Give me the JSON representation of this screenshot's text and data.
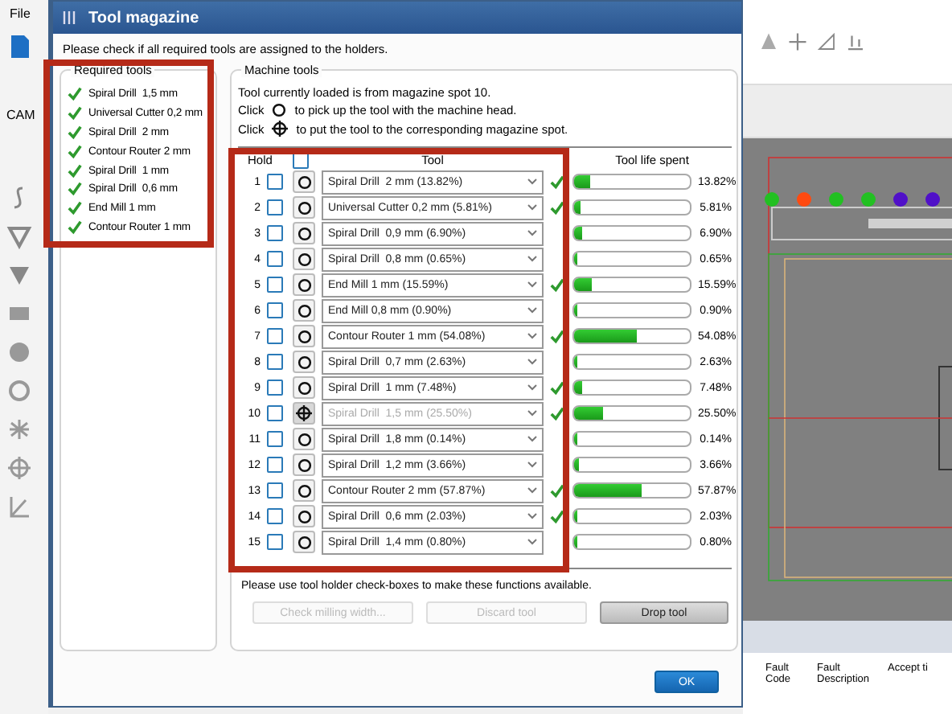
{
  "app": {
    "menu": "File",
    "tab": "CAM"
  },
  "dialog": {
    "title": "Tool magazine",
    "instruction": "Please check if all required tools are assigned to the holders.",
    "required_tools": {
      "title": "Required tools",
      "items": [
        {
          "label": "Spiral Drill  1,5 mm",
          "assigned": true
        },
        {
          "label": "Universal Cutter 0,2 mm",
          "assigned": true
        },
        {
          "label": "Spiral Drill  2 mm",
          "assigned": true
        },
        {
          "label": "Contour Router 2 mm",
          "assigned": true
        },
        {
          "label": "Spiral Drill  1 mm",
          "assigned": true
        },
        {
          "label": "Spiral Drill  0,6 mm",
          "assigned": true
        },
        {
          "label": "End Mill 1 mm",
          "assigned": true
        },
        {
          "label": "Contour Router 1 mm",
          "assigned": true
        }
      ]
    },
    "machine_tools": {
      "title": "Machine tools",
      "info": "Tool currently loaded is from magazine spot 10.",
      "hints": [
        {
          "kind": "pick",
          "before": "Click",
          "after": "to pick up the tool with the machine head."
        },
        {
          "kind": "put",
          "before": "Click",
          "after": "to put the tool to the corresponding magazine spot."
        }
      ],
      "columns": [
        "Hold",
        "Tool",
        "Tool life spent"
      ],
      "all_checked": false,
      "rows": [
        {
          "number": "1",
          "checked": false,
          "kind": "pick",
          "tool": "Spiral Drill  2 mm (13.82%)",
          "disabled": false,
          "assigned": true,
          "level": 0.1382,
          "percent": "13.82%"
        },
        {
          "number": "2",
          "checked": false,
          "kind": "pick",
          "tool": "Universal Cutter 0,2 mm (5.81%)",
          "disabled": false,
          "assigned": true,
          "level": 0.0581,
          "percent": "5.81%"
        },
        {
          "number": "3",
          "checked": false,
          "kind": "pick",
          "tool": "Spiral Drill  0,9 mm (6.90%)",
          "disabled": false,
          "assigned": false,
          "level": 0.069,
          "percent": "6.90%"
        },
        {
          "number": "4",
          "checked": false,
          "kind": "pick",
          "tool": "Spiral Drill  0,8 mm (0.65%)",
          "disabled": false,
          "assigned": false,
          "level": 0.0065,
          "percent": "0.65%"
        },
        {
          "number": "5",
          "checked": false,
          "kind": "pick",
          "tool": "End Mill 1 mm (15.59%)",
          "disabled": false,
          "assigned": true,
          "level": 0.1559,
          "percent": "15.59%"
        },
        {
          "number": "6",
          "checked": false,
          "kind": "pick",
          "tool": "End Mill 0,8 mm (0.90%)",
          "disabled": false,
          "assigned": false,
          "level": 0.009,
          "percent": "0.90%"
        },
        {
          "number": "7",
          "checked": false,
          "kind": "pick",
          "tool": "Contour Router 1 mm (54.08%)",
          "disabled": false,
          "assigned": true,
          "level": 0.5408,
          "percent": "54.08%"
        },
        {
          "number": "8",
          "checked": false,
          "kind": "pick",
          "tool": "Spiral Drill  0,7 mm (2.63%)",
          "disabled": false,
          "assigned": false,
          "level": 0.0263,
          "percent": "2.63%"
        },
        {
          "number": "9",
          "checked": false,
          "kind": "pick",
          "tool": "Spiral Drill  1 mm (7.48%)",
          "disabled": false,
          "assigned": true,
          "level": 0.0748,
          "percent": "7.48%"
        },
        {
          "number": "10",
          "checked": false,
          "kind": "put",
          "tool": "Spiral Drill  1,5 mm (25.50%)",
          "disabled": true,
          "assigned": true,
          "level": 0.255,
          "percent": "25.50%"
        },
        {
          "number": "11",
          "checked": false,
          "kind": "pick",
          "tool": "Spiral Drill  1,8 mm (0.14%)",
          "disabled": false,
          "assigned": false,
          "level": 0.0014,
          "percent": "0.14%"
        },
        {
          "number": "12",
          "checked": false,
          "kind": "pick",
          "tool": "Spiral Drill  1,2 mm (3.66%)",
          "disabled": false,
          "assigned": false,
          "level": 0.0366,
          "percent": "3.66%"
        },
        {
          "number": "13",
          "checked": false,
          "kind": "pick",
          "tool": "Contour Router 2 mm (57.87%)",
          "disabled": false,
          "assigned": true,
          "level": 0.5787,
          "percent": "57.87%"
        },
        {
          "number": "14",
          "checked": false,
          "kind": "pick",
          "tool": "Spiral Drill  0,6 mm (2.03%)",
          "disabled": false,
          "assigned": true,
          "level": 0.0203,
          "percent": "2.03%"
        },
        {
          "number": "15",
          "checked": false,
          "kind": "pick",
          "tool": "Spiral Drill  1,4 mm (0.80%)",
          "disabled": false,
          "assigned": false,
          "level": 0.008,
          "percent": "0.80%"
        }
      ],
      "note": "Please use tool holder check-boxes to make these functions available.",
      "buttons": [
        {
          "label": "Check milling width...",
          "disabled": true
        },
        {
          "label": "Discard tool",
          "disabled": true
        },
        {
          "label": "Drop tool",
          "disabled": false
        }
      ]
    },
    "ok": "OK"
  },
  "canvas": {
    "dots": [
      {
        "color": "#22c022"
      },
      {
        "color": "#ff4a10"
      },
      {
        "color": "#22c022"
      },
      {
        "color": "#22c022"
      },
      {
        "color": "#5010c8"
      },
      {
        "color": "#5010c8"
      }
    ]
  },
  "fault_table": {
    "columns": [
      "Fault Code",
      "Fault Description",
      "Accept ti"
    ]
  }
}
